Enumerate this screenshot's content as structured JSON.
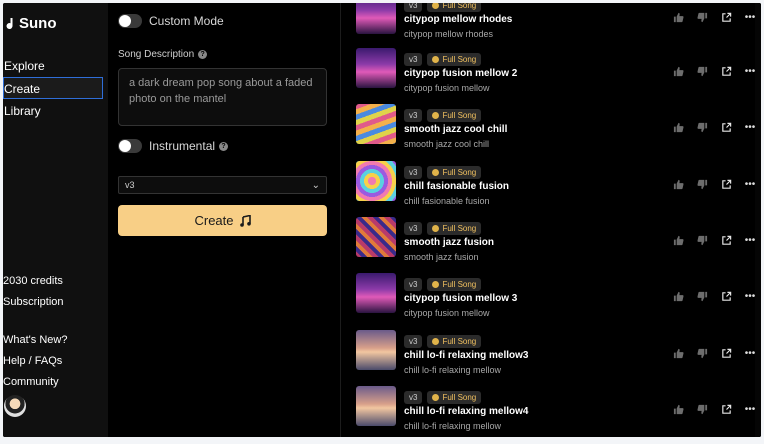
{
  "app": {
    "name": "Suno"
  },
  "sidebar": {
    "nav": [
      {
        "label": "Explore"
      },
      {
        "label": "Create"
      },
      {
        "label": "Library"
      }
    ],
    "credits": "2030 credits",
    "subscription": "Subscription",
    "whats_new": "What's New?",
    "help": "Help / FAQs",
    "community": "Community"
  },
  "form": {
    "custom_mode_label": "Custom Mode",
    "song_description_label": "Song Description",
    "song_description_value": "a dark dream pop song about a faded photo on the mantel",
    "instrumental_label": "Instrumental",
    "model_value": "v3",
    "create_label": "Create"
  },
  "songs": [
    {
      "version": "v3",
      "badge": "Full Song",
      "title": "citypop mellow rhodes",
      "style": "citypop mellow rhodes",
      "thumb": "city"
    },
    {
      "version": "v3",
      "badge": "Full Song",
      "title": "citypop fusion mellow 2",
      "style": "citypop fusion mellow",
      "thumb": "city"
    },
    {
      "version": "v3",
      "badge": "Full Song",
      "title": "smooth jazz cool chill",
      "style": "smooth jazz cool chill",
      "thumb": "wave"
    },
    {
      "version": "v3",
      "badge": "Full Song",
      "title": "chill fasionable fusion",
      "style": "chill fasionable fusion",
      "thumb": "swirl"
    },
    {
      "version": "v3",
      "badge": "Full Song",
      "title": "smooth jazz fusion",
      "style": "smooth jazz fusion",
      "thumb": "pattern"
    },
    {
      "version": "v3",
      "badge": "Full Song",
      "title": "citypop fusion mellow 3",
      "style": "citypop fusion mellow",
      "thumb": "city"
    },
    {
      "version": "v3",
      "badge": "Full Song",
      "title": "chill lo-fi relaxing mellow3",
      "style": "chill lo-fi relaxing mellow",
      "thumb": "sea"
    },
    {
      "version": "v3",
      "badge": "Full Song",
      "title": "chill lo-fi relaxing mellow4",
      "style": "chill lo-fi relaxing mellow",
      "thumb": "sea"
    }
  ],
  "icons": {
    "like": "thumbs-up-icon",
    "dislike": "thumbs-down-icon",
    "share": "share-icon",
    "more": "more-icon"
  },
  "colors": {
    "accent": "#f8cf86",
    "badge_gold": "#f0c060",
    "active_outline": "#2f6ed8"
  }
}
